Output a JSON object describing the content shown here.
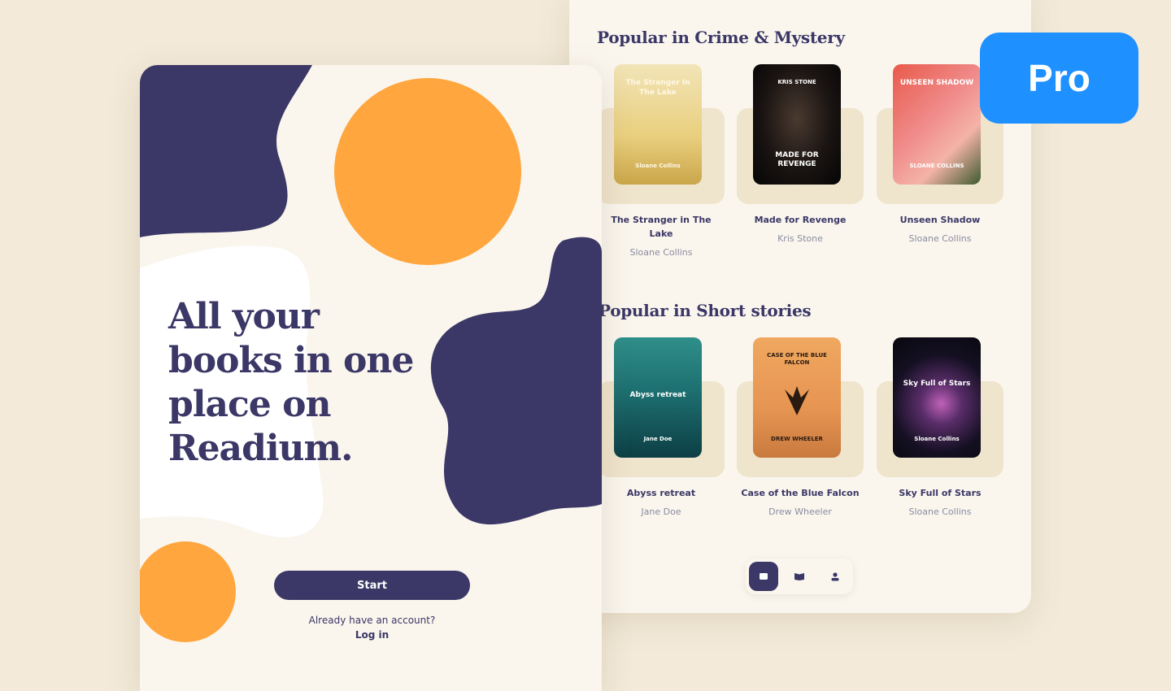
{
  "pro_badge": {
    "label": "Pro",
    "color": "#1e90ff"
  },
  "colors": {
    "primary": "#3b3766",
    "accent": "#ffa63f",
    "background": "#faf6ee"
  },
  "library": {
    "sections": [
      {
        "title": "Popular in Crime & Mystery",
        "books": [
          {
            "title": "The Stranger in The Lake",
            "author": "Sloane Collins",
            "cover_text_top": "The Stranger In The Lake",
            "cover_text_bottom": "Sloane Collins"
          },
          {
            "title": "Made for Revenge",
            "author": "Kris Stone",
            "cover_text_top": "KRIS STONE",
            "cover_text_bottom": "MADE FOR REVENGE"
          },
          {
            "title": "Unseen Shadow",
            "author": "Sloane Collins",
            "cover_text_top": "UNSEEN SHADOW",
            "cover_text_bottom": "SLOANE COLLINS"
          }
        ]
      },
      {
        "title": "Popular in Short stories",
        "books": [
          {
            "title": "Abyss retreat",
            "author": "Jane Doe",
            "cover_text_top": "Abyss retreat",
            "cover_text_bottom": "Jane Doe"
          },
          {
            "title": "Case of the Blue Falcon",
            "author": "Drew Wheeler",
            "cover_text_top": "CASE OF THE BLUE FALCON",
            "cover_text_bottom": "DREW WHEELER"
          },
          {
            "title": "Sky Full of Stars",
            "author": "Sloane Collins",
            "cover_text_top": "Sky Full of Stars",
            "cover_text_bottom": "Sloane Collins"
          }
        ]
      }
    ],
    "tabs": [
      {
        "icon": "home-icon",
        "active": true
      },
      {
        "icon": "book-icon",
        "active": false
      },
      {
        "icon": "profile-icon",
        "active": false
      }
    ]
  },
  "onboarding": {
    "headline": "All your books in one place on Readium.",
    "start_label": "Start",
    "account_prompt": "Already have an account?",
    "login_label": "Log in"
  }
}
